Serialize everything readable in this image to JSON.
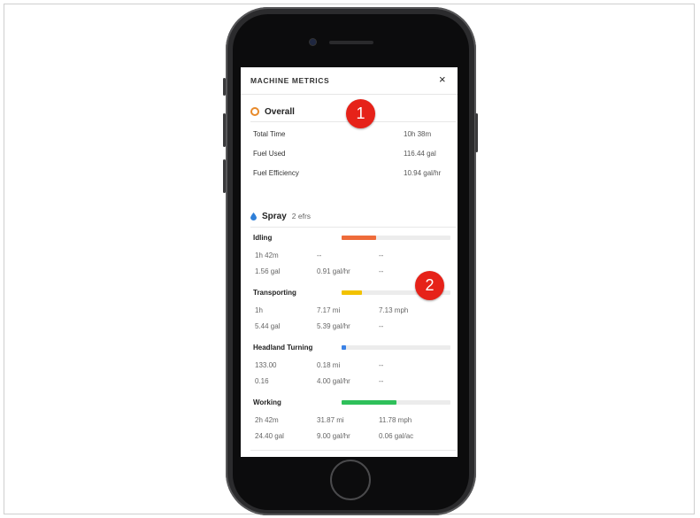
{
  "header": {
    "title": "MACHINE METRICS",
    "close_label": "×"
  },
  "overall": {
    "title": "Overall",
    "rows": [
      {
        "label": "Total Time",
        "value": "10h 38m"
      },
      {
        "label": "Fuel Used",
        "value": "116.44 gal"
      },
      {
        "label": "Fuel Efficiency",
        "value": "10.94 gal/hr"
      }
    ]
  },
  "spray": {
    "title": "Spray",
    "subtitle": "2 efrs",
    "categories": [
      {
        "label": "Idling",
        "bar_fraction": 0.32,
        "bar_color": "#ee6b3a",
        "row1": [
          "1h 42m",
          "--",
          "--"
        ],
        "row2": [
          "1.56 gal",
          "0.91 gal/hr",
          "--"
        ]
      },
      {
        "label": "Transporting",
        "bar_fraction": 0.19,
        "bar_color": "#f2c200",
        "row1": [
          "1h",
          "7.17 mi",
          "7.13 mph"
        ],
        "row2": [
          "5.44 gal",
          "5.39 gal/hr",
          "--"
        ]
      },
      {
        "label": "Headland Turning",
        "bar_fraction": 0.04,
        "bar_color": "#3b82e6",
        "row1": [
          "133.00",
          "0.18 mi",
          "--"
        ],
        "row2": [
          "0.16",
          "4.00 gal/hr",
          "--"
        ]
      },
      {
        "label": "Working",
        "bar_fraction": 0.5,
        "bar_color": "#2fc05a",
        "row1": [
          "2h 42m",
          "31.87 mi",
          "11.78 mph"
        ],
        "row2": [
          "24.40 gal",
          "9.00 gal/hr",
          "0.06 gal/ac"
        ]
      }
    ]
  },
  "callouts": [
    "1",
    "2"
  ],
  "colors": {
    "overall_icon": "#e88a2a",
    "spray_icon": "#2f7fd8",
    "callout": "#e62219"
  }
}
